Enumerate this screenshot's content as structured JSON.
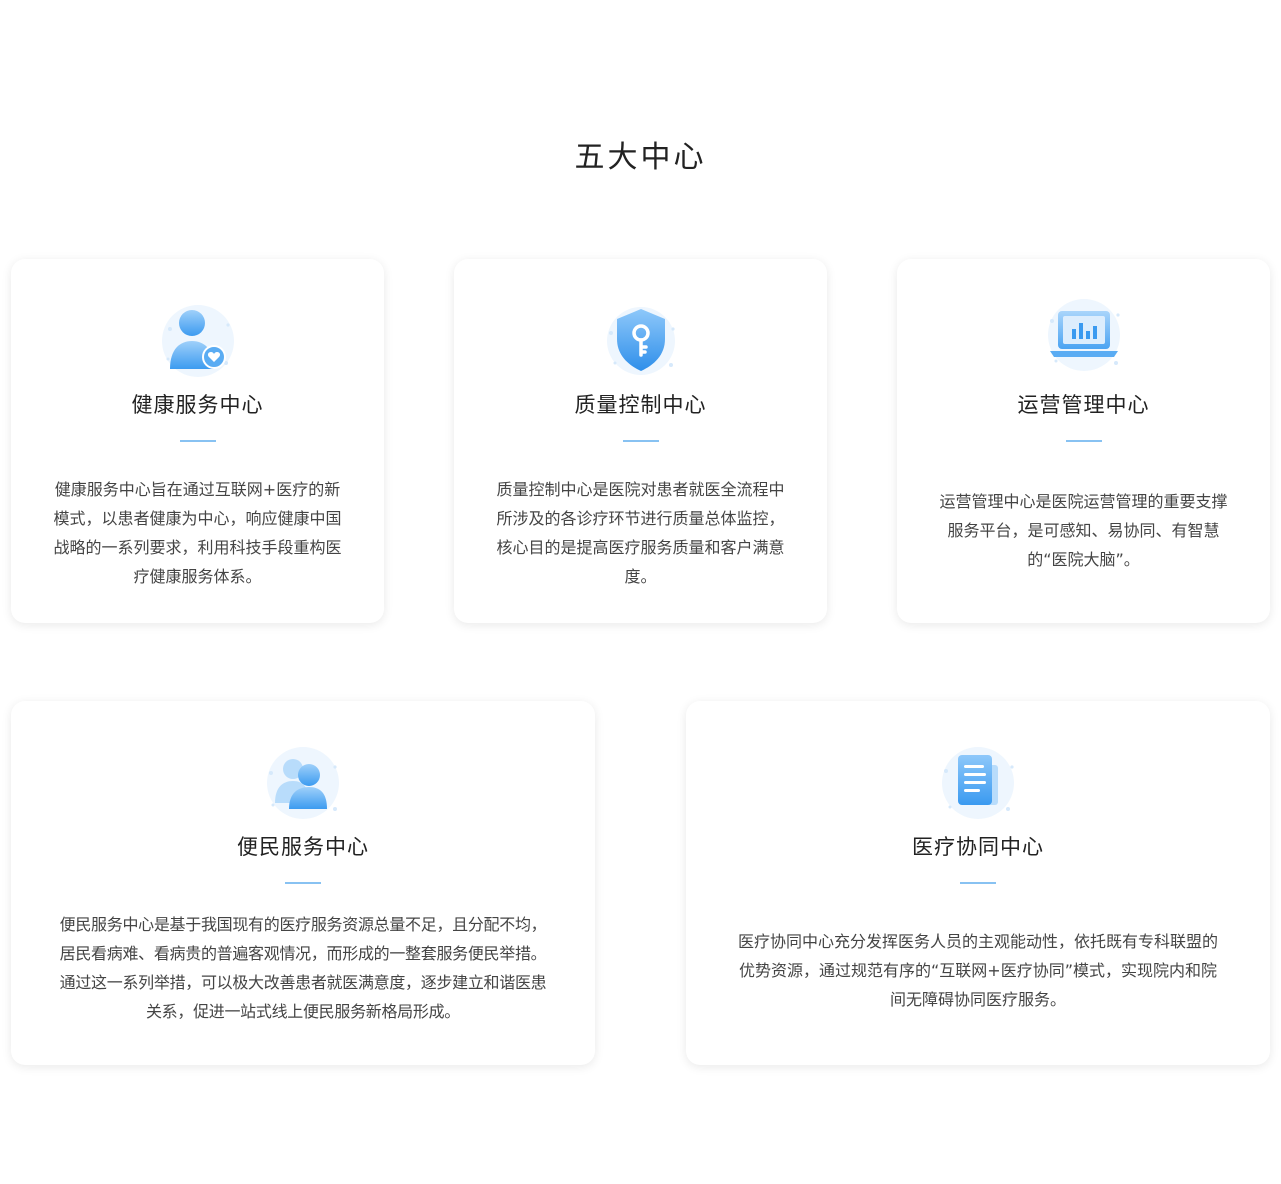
{
  "section": {
    "title": "五大中心"
  },
  "cards": [
    {
      "title": "健康服务中心",
      "icon": "health-user-icon",
      "desc": "健康服务中心旨在通过互联网+医疗的新模式，以患者健康为中心，响应健康中国战略的一系列要求，利用科技手段重构医疗健康服务体系。"
    },
    {
      "title": "质量控制中心",
      "icon": "shield-key-icon",
      "desc": "质量控制中心是医院对患者就医全流程中所涉及的各诊疗环节进行质量总体监控，核心目的是提高医疗服务质量和客户满意度。"
    },
    {
      "title": "运营管理中心",
      "icon": "laptop-chart-icon",
      "desc": "运营管理中心是医院运营管理的重要支撑服务平台，是可感知、易协同、有智慧的“医院大脑”。"
    },
    {
      "title": "便民服务中心",
      "icon": "users-icon",
      "desc": "便民服务中心是基于我国现有的医疗服务资源总量不足，且分配不均，居民看病难、看病贵的普遍客观情况，而形成的一整套服务便民举措。通过这一系列举措，可以极大改善患者就医满意度，逐步建立和谐医患关系，促进一站式线上便民服务新格局形成。"
    },
    {
      "title": "医疗协同中心",
      "icon": "document-icon",
      "desc": "医疗协同中心充分发挥医务人员的主观能动性，依托既有专科联盟的优势资源，通过规范有序的“互联网+医疗协同”模式，实现院内和院间无障碍协同医疗服务。"
    }
  ],
  "colors": {
    "accent": "#88c2f2",
    "icon_blue": "#3a9af0",
    "icon_light": "#cfe6fc"
  }
}
